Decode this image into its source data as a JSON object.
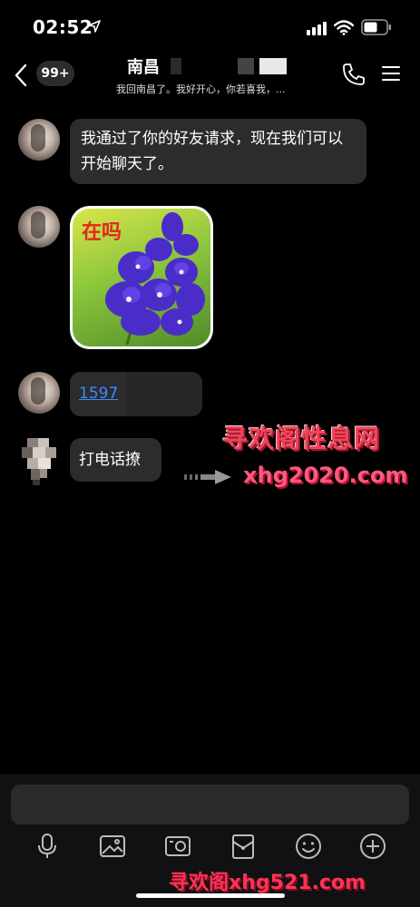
{
  "status_bar": {
    "time": "02:52"
  },
  "header": {
    "unread_count": "99+",
    "title": "南昌",
    "subtitle": "我回南昌了。我好开心，你若喜我，..."
  },
  "messages": [
    {
      "type": "text",
      "text": "我通过了你的好友请求，现在我们可以开始聊天了。"
    },
    {
      "type": "image",
      "caption": "在吗"
    },
    {
      "type": "link",
      "text": "1597"
    },
    {
      "type": "text",
      "text": "打电话撩"
    }
  ],
  "watermark": {
    "title": "寻欢阁性息网",
    "url": "xhg2020.com",
    "bottom": "寻欢阁xhg521.com"
  },
  "input": {
    "placeholder": ""
  },
  "toolbar": {
    "icons": [
      "microphone-icon",
      "image-icon",
      "camera-icon",
      "red-packet-icon",
      "emoji-icon",
      "plus-icon"
    ]
  },
  "colors": {
    "background": "#000000",
    "bubble": "#2c2c2e",
    "link": "#3b8cff",
    "watermark": "#f0455a"
  }
}
